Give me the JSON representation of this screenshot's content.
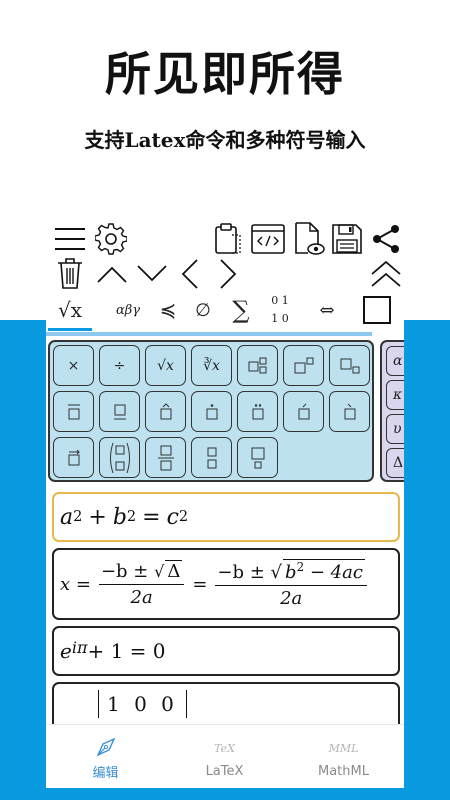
{
  "hero": {
    "title": "所见即所得",
    "subtitle": "支持Latex命令和多种符号输入"
  },
  "toolbar": {
    "icons": [
      "menu-icon",
      "gear-icon",
      "clipboard-icon",
      "code-icon",
      "file-preview-icon",
      "save-icon",
      "share-icon",
      "trash-icon",
      "caret-up-icon",
      "caret-down-icon",
      "caret-left-icon",
      "caret-right-icon",
      "double-caret-up-icon"
    ]
  },
  "symbol_tabs": {
    "sqrt": "√x",
    "greek": "αβγ",
    "relation": "≼",
    "set": "∅",
    "sum": "∑",
    "matrix_top": "0 1",
    "matrix_bottom": "1 0",
    "arrow": "⇔"
  },
  "keypad": {
    "row1": [
      "×",
      "÷",
      "√x",
      "∛x"
    ],
    "side": [
      "α",
      "κ",
      "υ",
      "Δ"
    ]
  },
  "equations": {
    "pythagoras": {
      "a": "a",
      "b": "b",
      "c": "c",
      "exp": "2",
      "plus": "+",
      "eq": "="
    },
    "quadratic": {
      "lhs": "x =",
      "num1": "−b ± ",
      "delta": "Δ",
      "den": "2a",
      "eq": "=",
      "num2": "−b ± ",
      "b2": "b",
      "exp": "2",
      "rest": " − 4ac",
      "den2": "2a"
    },
    "euler": {
      "e": "e",
      "exp": "iπ",
      "rest": " + 1 = 0"
    },
    "matrix": {
      "row": "1 0 0"
    }
  },
  "bottom_nav": {
    "edit": {
      "label": "编辑",
      "icon": "pen-nib-icon"
    },
    "latex": {
      "label": "LaTeX",
      "logo": "TeX"
    },
    "mathml": {
      "label": "MathML",
      "logo": "MML"
    }
  },
  "colors": {
    "accent": "#0a9ae0",
    "keypad": "#bde1ef",
    "active_border": "#e8b84a",
    "nav_active": "#3d8fd6"
  }
}
